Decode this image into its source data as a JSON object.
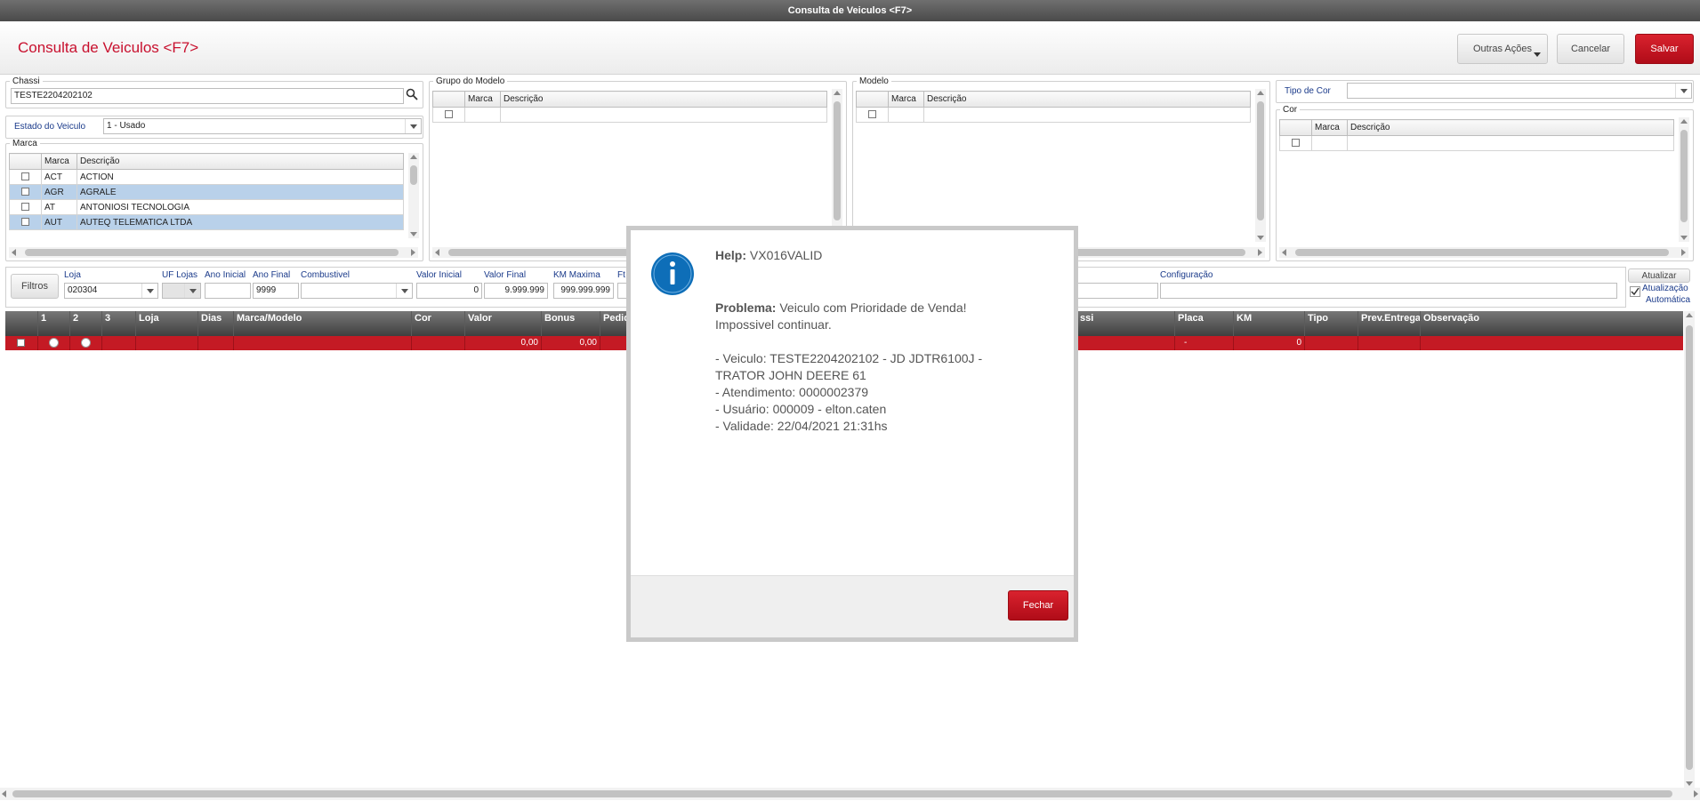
{
  "window": {
    "title": "Consulta de Veiculos <F7>"
  },
  "header": {
    "title": "Consulta de Veiculos <F7>",
    "outras_acoes": "Outras Ações",
    "cancelar": "Cancelar",
    "salvar": "Salvar"
  },
  "chassi": {
    "legend": "Chassi",
    "value": "TESTE2204202102"
  },
  "estado": {
    "label": "Estado do Veiculo",
    "value": "1 - Usado"
  },
  "marca": {
    "legend": "Marca",
    "col_marca": "Marca",
    "col_descricao": "Descrição",
    "rows": [
      {
        "code": "ACT",
        "desc": "ACTION"
      },
      {
        "code": "AGR",
        "desc": "AGRALE"
      },
      {
        "code": "AT",
        "desc": "ANTONIOSI TECNOLOGIA"
      },
      {
        "code": "AUT",
        "desc": "AUTEQ TELEMATICA LTDA"
      }
    ]
  },
  "grupo_modelo": {
    "legend": "Grupo do Modelo",
    "col_marca": "Marca",
    "col_descricao": "Descrição"
  },
  "modelo": {
    "legend": "Modelo",
    "col_marca": "Marca",
    "col_descricao": "Descrição"
  },
  "tipo_cor": {
    "label": "Tipo de Cor",
    "value": ""
  },
  "cor": {
    "legend": "Cor",
    "col_marca": "Marca",
    "col_descricao": "Descrição"
  },
  "filters": {
    "filtros": "Filtros",
    "loja_label": "Loja",
    "loja_value": "020304",
    "uf_label": "UF Lojas",
    "ano_ini_label": "Ano Inicial",
    "ano_ini_value": "",
    "ano_fin_label": "Ano Final",
    "ano_fin_value": "9999",
    "comb_label": "Combustivel",
    "val_ini_label": "Valor Inicial",
    "val_ini_value": "0",
    "val_fin_label": "Valor Final",
    "val_fin_value": "9.999.999",
    "km_label": "KM Maxima",
    "km_value": "999.999.999",
    "ft_label": "Ft",
    "config_label": "Configuração",
    "atualizar": "Atualizar",
    "auto_label_1": "Atualização",
    "auto_label_2": "Automática"
  },
  "results": {
    "columns": [
      "1",
      "2",
      "3",
      "Loja",
      "Dias",
      "Marca/Modelo",
      "Cor",
      "Valor",
      "Bonus",
      "Pedid",
      "ssi",
      "Placa",
      "KM",
      "Tipo",
      "Prev.Entrega",
      "Observação"
    ],
    "row": {
      "valor": "0,00",
      "bonus": "0,00",
      "placa": "-",
      "km": "0"
    }
  },
  "dialog": {
    "help_label": "Help:",
    "help_code": "VX016VALID",
    "problema_label": "Problema:",
    "problema_text": "Veiculo com Prioridade de Venda!",
    "line2": "Impossivel continuar.",
    "line3": "- Veiculo: TESTE2204202102 - JD JDTR6100J -",
    "line4": "TRATOR JOHN DEERE 61",
    "line5": "- Atendimento: 0000002379",
    "line6": "- Usuário: 000009 - elton.caten",
    "line7": "- Validade: 22/04/2021 21:31hs",
    "fechar": "Fechar"
  }
}
